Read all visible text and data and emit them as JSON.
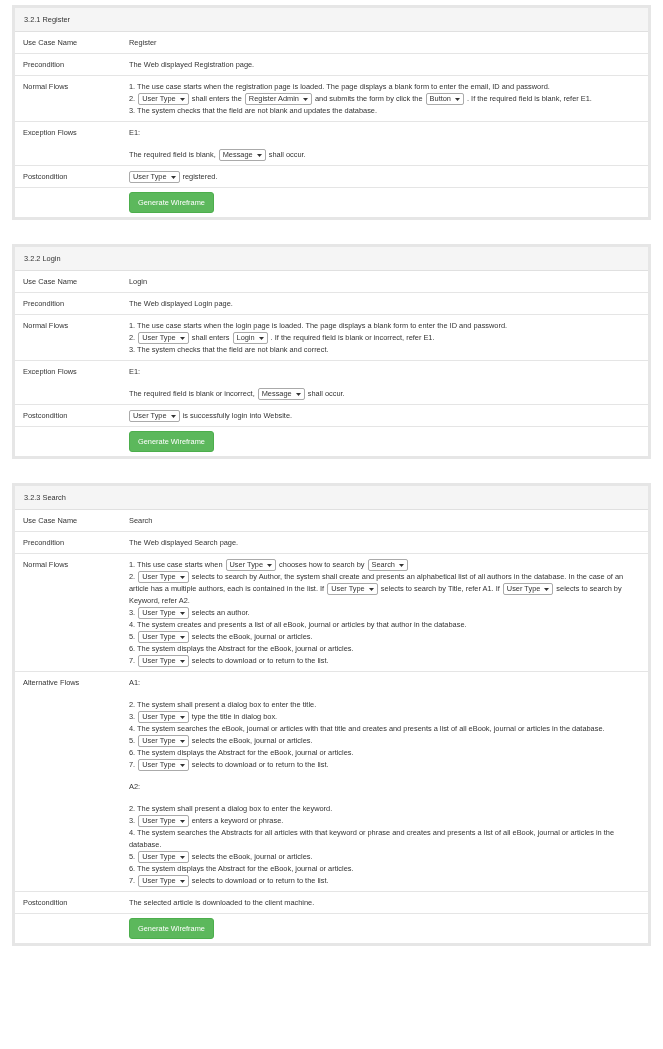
{
  "panels": [
    {
      "title": "3.2.1 Register",
      "rows": [
        {
          "label": "Use Case Name",
          "blocks": [
            [
              [
                {
                  "text": "Register"
                }
              ]
            ]
          ]
        },
        {
          "label": "Precondition",
          "blocks": [
            [
              [
                {
                  "text": "The Web displayed Registration page."
                }
              ]
            ]
          ]
        },
        {
          "label": "Normal Flows",
          "blocks": [
            [
              [
                {
                  "text": "1. The use case starts when the registration page is loaded. The page displays a blank form to enter the email, ID and password."
                }
              ],
              [
                {
                  "text": "2."
                },
                {
                  "dropdown": "User Type"
                },
                {
                  "text": "shall enters the"
                },
                {
                  "dropdown": "Register Admin"
                },
                {
                  "text": "and submits the form by click the"
                },
                {
                  "dropdown": "Button"
                },
                {
                  "text": ". If the required field is blank, refer E1."
                }
              ],
              [
                {
                  "text": "3. The system checks that the field are not blank and updates the database."
                }
              ]
            ]
          ]
        },
        {
          "label": "Exception Flows",
          "blocks": [
            [
              [
                {
                  "text": "E1:"
                }
              ]
            ],
            [
              [
                {
                  "text": "The required field is blank,"
                },
                {
                  "dropdown": "Message"
                },
                {
                  "text": "shall occur."
                }
              ]
            ]
          ]
        },
        {
          "label": "Postcondition",
          "blocks": [
            [
              [
                {
                  "dropdown": "User Type"
                },
                {
                  "text": "registered."
                }
              ]
            ]
          ]
        }
      ],
      "button": "Generate Wireframe"
    },
    {
      "title": "3.2.2 Login",
      "rows": [
        {
          "label": "Use Case Name",
          "blocks": [
            [
              [
                {
                  "text": "Login"
                }
              ]
            ]
          ]
        },
        {
          "label": "Precondition",
          "blocks": [
            [
              [
                {
                  "text": "The Web displayed Login page."
                }
              ]
            ]
          ]
        },
        {
          "label": "Normal Flows",
          "blocks": [
            [
              [
                {
                  "text": "1. The use case starts when the login page is loaded. The page displays a blank form to enter the ID and password."
                }
              ],
              [
                {
                  "text": "2."
                },
                {
                  "dropdown": "User Type"
                },
                {
                  "text": "shall enters"
                },
                {
                  "dropdown": "Login"
                },
                {
                  "text": ". If the required field is blank or incorrect, refer E1."
                }
              ],
              [
                {
                  "text": "3. The system checks that the field are not blank and correct."
                }
              ]
            ]
          ]
        },
        {
          "label": "Exception Flows",
          "blocks": [
            [
              [
                {
                  "text": "E1:"
                }
              ]
            ],
            [
              [
                {
                  "text": "The required field is blank or incorrect,"
                },
                {
                  "dropdown": "Message"
                },
                {
                  "text": "shall occur."
                }
              ]
            ]
          ]
        },
        {
          "label": "Postcondition",
          "blocks": [
            [
              [
                {
                  "dropdown": "User Type"
                },
                {
                  "text": "is successfully login into Website."
                }
              ]
            ]
          ]
        }
      ],
      "button": "Generate Wireframe"
    },
    {
      "title": "3.2.3 Search",
      "rows": [
        {
          "label": "Use Case Name",
          "blocks": [
            [
              [
                {
                  "text": "Search"
                }
              ]
            ]
          ]
        },
        {
          "label": "Precondition",
          "blocks": [
            [
              [
                {
                  "text": "The Web displayed Search page."
                }
              ]
            ]
          ]
        },
        {
          "label": "Normal Flows",
          "blocks": [
            [
              [
                {
                  "text": "1. This use case starts when"
                },
                {
                  "dropdown": "User Type"
                },
                {
                  "text": "chooses how to search by"
                },
                {
                  "dropdown": "Search"
                }
              ],
              [
                {
                  "text": "2."
                },
                {
                  "dropdown": "User Type"
                },
                {
                  "text": "selects to search by Author, the system shall create and presents an alphabetical list of all authors in the database. In the case of an"
                }
              ],
              [
                {
                  "text": "article has a multiple authors, each is contained in the list. If"
                },
                {
                  "dropdown": "User Type"
                },
                {
                  "text": "selects to search by Title, refer A1. If"
                },
                {
                  "dropdown": "User Type"
                },
                {
                  "text": "selects to search by"
                }
              ],
              [
                {
                  "text": "Keyword, refer A2."
                }
              ],
              [
                {
                  "text": "3."
                },
                {
                  "dropdown": "User Type"
                },
                {
                  "text": "selects an author."
                }
              ],
              [
                {
                  "text": "4. The system creates and presents a list of all eBook, journal or articles by that author in the database."
                }
              ],
              [
                {
                  "text": "5."
                },
                {
                  "dropdown": "User Type"
                },
                {
                  "text": "selects the eBook, journal or articles."
                }
              ],
              [
                {
                  "text": "6. The system displays the Abstract for the eBook, journal or articles."
                }
              ],
              [
                {
                  "text": "7."
                },
                {
                  "dropdown": "User Type"
                },
                {
                  "text": "selects to download or to return to the list."
                }
              ]
            ]
          ]
        },
        {
          "label": "Alternative Flows",
          "blocks": [
            [
              [
                {
                  "text": "A1:"
                }
              ]
            ],
            [
              [
                {
                  "text": "2. The system shall present a dialog box to enter the title."
                }
              ],
              [
                {
                  "text": "3."
                },
                {
                  "dropdown": "User Type"
                },
                {
                  "text": "type the title in dialog box."
                }
              ],
              [
                {
                  "text": "4. The system searches the eBook, journal or articles with that title and creates and presents a list of all eBook, journal or articles in the database."
                }
              ],
              [
                {
                  "text": "5."
                },
                {
                  "dropdown": "User Type"
                },
                {
                  "text": "selects the eBook, journal or articles."
                }
              ],
              [
                {
                  "text": "6. The system displays the Abstract for the eBook, journal or articles."
                }
              ],
              [
                {
                  "text": "7."
                },
                {
                  "dropdown": "User Type"
                },
                {
                  "text": "selects to download or to return to the list."
                }
              ]
            ],
            [
              [
                {
                  "text": "A2:"
                }
              ]
            ],
            [
              [
                {
                  "text": "2. The system shall present a dialog box to enter the keyword."
                }
              ],
              [
                {
                  "text": "3."
                },
                {
                  "dropdown": "User Type"
                },
                {
                  "text": "enters a keyword or phrase."
                }
              ],
              [
                {
                  "text": "4. The system searches the Abstracts for all articles with that keyword or phrase and creates and presents a list of all eBook, journal or articles in the"
                }
              ],
              [
                {
                  "text": "database."
                }
              ],
              [
                {
                  "text": "5."
                },
                {
                  "dropdown": "User Type"
                },
                {
                  "text": "selects the eBook, journal or articles."
                }
              ],
              [
                {
                  "text": "6. The system displays the Abstract for the eBook, journal or articles."
                }
              ],
              [
                {
                  "text": "7."
                },
                {
                  "dropdown": "User Type"
                },
                {
                  "text": "selects to download or to return to the list."
                }
              ]
            ]
          ]
        },
        {
          "label": "Postcondition",
          "blocks": [
            [
              [
                {
                  "text": "The selected article is downloaded to the client machine."
                }
              ]
            ]
          ]
        }
      ],
      "button": "Generate Wireframe"
    }
  ]
}
